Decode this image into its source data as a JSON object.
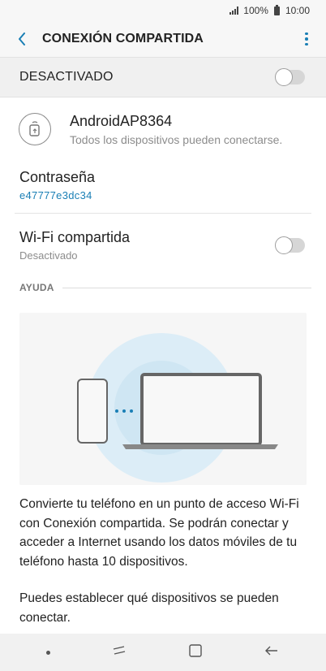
{
  "status": {
    "signal_icon": "signal-bars-icon",
    "battery_pct": "100%",
    "time": "10:00"
  },
  "header": {
    "title": "CONEXIÓN COMPARTIDA",
    "back_icon": "chevron-left-icon",
    "menu_icon": "more-vertical-icon"
  },
  "master_toggle": {
    "label": "DESACTIVADO",
    "enabled": false
  },
  "network": {
    "name": "AndroidAP8364",
    "subtitle": "Todos los dispositivos pueden conectarse.",
    "icon": "hotspot-settings-icon"
  },
  "password": {
    "title": "Contraseña",
    "value": "e47777e3dc34"
  },
  "wifi_sharing": {
    "title": "Wi-Fi compartida",
    "status": "Desactivado",
    "enabled": false
  },
  "help": {
    "section_label": "AYUDA",
    "illustration": "phone-laptop-hotspot-illustration",
    "paragraph_1": "Convierte tu teléfono en un punto de acceso Wi-Fi con Conexión compartida. Se podrán conectar y acceder a Internet usando los datos móviles de tu teléfono hasta 10 dispositivos.",
    "paragraph_2": "Puedes establecer qué dispositivos se pueden conectar."
  },
  "colors": {
    "accent": "#1a7fb5",
    "hotspot_circle": "#dcedf7"
  },
  "navbar": {
    "items": [
      "dot-icon",
      "recents-icon",
      "home-icon",
      "back-icon"
    ]
  }
}
